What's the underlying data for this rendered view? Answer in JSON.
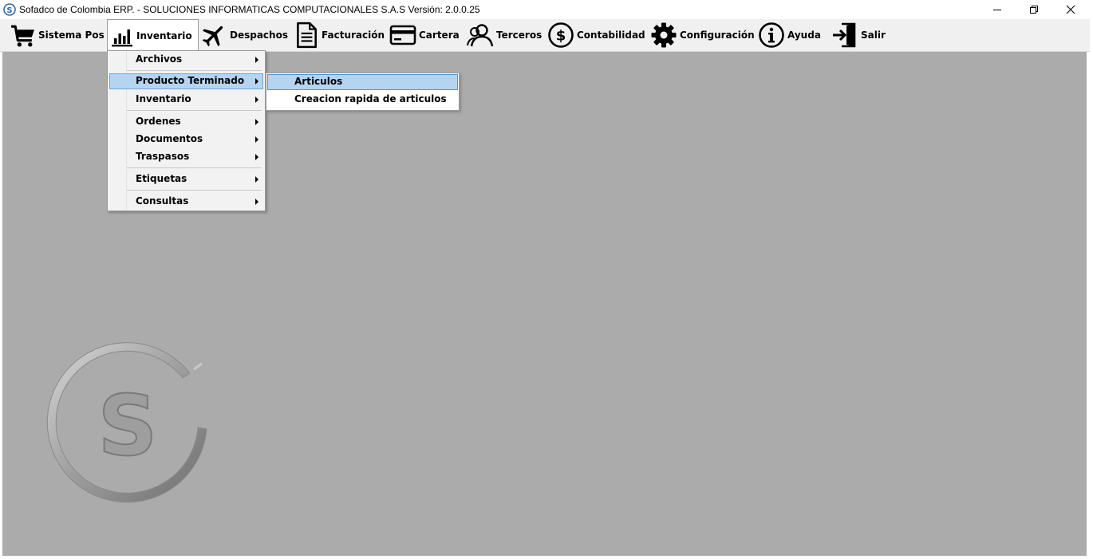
{
  "window": {
    "title": "Sofadco de Colombia ERP. - SOLUCIONES INFORMATICAS COMPUTACIONALES S.A.S  Versión: 2.0.0.25",
    "app_icon_letter": "S"
  },
  "menubar": [
    {
      "id": "sistema-pos",
      "label": "Sistema Pos",
      "icon": "cart-icon"
    },
    {
      "id": "inventario",
      "label": "Inventario",
      "icon": "bar-chart-icon"
    },
    {
      "id": "despachos",
      "label": "Despachos",
      "icon": "airplane-icon"
    },
    {
      "id": "facturacion",
      "label": "Facturación",
      "icon": "document-icon"
    },
    {
      "id": "cartera",
      "label": "Cartera",
      "icon": "credit-card-icon"
    },
    {
      "id": "terceros",
      "label": "Terceros",
      "icon": "users-icon"
    },
    {
      "id": "contabilidad",
      "label": "Contabilidad",
      "icon": "dollar-circle-icon"
    },
    {
      "id": "configuracion",
      "label": "Configuración",
      "icon": "gear-icon"
    },
    {
      "id": "ayuda",
      "label": "Ayuda",
      "icon": "info-icon"
    },
    {
      "id": "salir",
      "label": "Salir",
      "icon": "exit-door-icon"
    }
  ],
  "inventario_menu": [
    {
      "label": "Archivos"
    },
    {
      "label": "Producto Terminado",
      "highlighted": true
    },
    {
      "label": "Inventario"
    },
    {
      "label": "Ordenes"
    },
    {
      "label": "Documentos"
    },
    {
      "label": "Traspasos"
    },
    {
      "label": "Etiquetas"
    },
    {
      "label": "Consultas"
    }
  ],
  "producto_terminado_submenu": [
    {
      "label": "Articulos",
      "highlighted": true
    },
    {
      "label": "Creacion rapida de articulos"
    }
  ],
  "logo": {
    "letter": "S"
  },
  "colors": {
    "menubar_bg": "#f0f0f0",
    "workspace_bg": "#ababab",
    "highlight_bg": "#b5d4f1",
    "highlight_border": "#4f93d4"
  }
}
